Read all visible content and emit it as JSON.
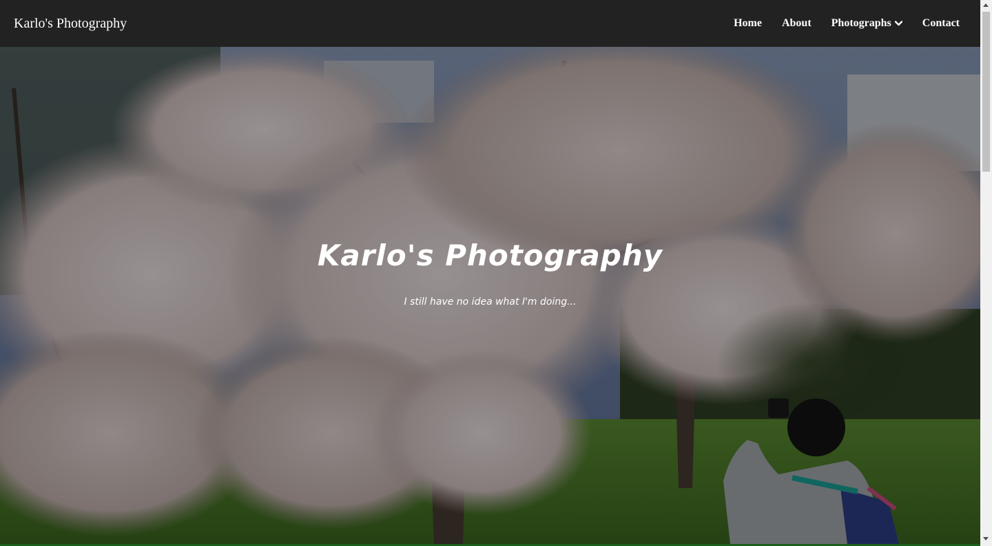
{
  "navbar": {
    "brand": "Karlo's Photography",
    "links": [
      {
        "label": "Home"
      },
      {
        "label": "About"
      },
      {
        "label": "Photographs",
        "icon": "chevron-down-icon"
      },
      {
        "label": "Contact"
      }
    ],
    "background": "#222222"
  },
  "hero": {
    "title": "Karlo's Photography",
    "subtitle": "I still have no idea what I'm doing..."
  }
}
